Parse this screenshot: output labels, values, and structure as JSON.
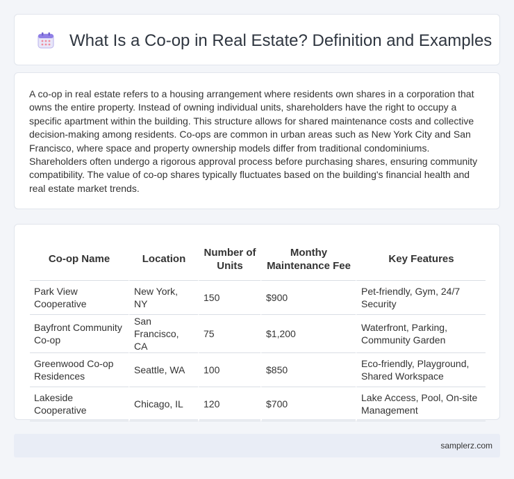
{
  "header": {
    "icon": "calendar-icon",
    "title": "What Is a Co-op in Real Estate? Definition and Examples"
  },
  "intro": {
    "text": "A co-op in real estate refers to a housing arrangement where residents own shares in a corporation that owns the entire property. Instead of owning individual units, shareholders have the right to occupy a specific apartment within the building. This structure allows for shared maintenance costs and collective decision-making among residents. Co-ops are common in urban areas such as New York City and San Francisco, where space and property ownership models differ from traditional condominiums. Shareholders often undergo a rigorous approval process before purchasing shares, ensuring community compatibility. The value of co-op shares typically fluctuates based on the building's financial health and real estate market trends."
  },
  "table": {
    "headers": [
      "Co-op Name",
      "Location",
      "Number of Units",
      "Monthy Maintenance Fee",
      "Key Features"
    ],
    "rows": [
      [
        "Park View Cooperative",
        "New York, NY",
        "150",
        "$900",
        "Pet-friendly, Gym, 24/7 Security"
      ],
      [
        "Bayfront Community Co-op",
        "San Francisco, CA",
        "75",
        "$1,200",
        "Waterfront, Parking, Community Garden"
      ],
      [
        "Greenwood Co-op Residences",
        "Seattle, WA",
        "100",
        "$850",
        "Eco-friendly, Playground, Shared Workspace"
      ],
      [
        "Lakeside Cooperative",
        "Chicago, IL",
        "120",
        "$700",
        "Lake Access, Pool, On-site Management"
      ]
    ]
  },
  "footer": {
    "text": "samplerz.com"
  }
}
